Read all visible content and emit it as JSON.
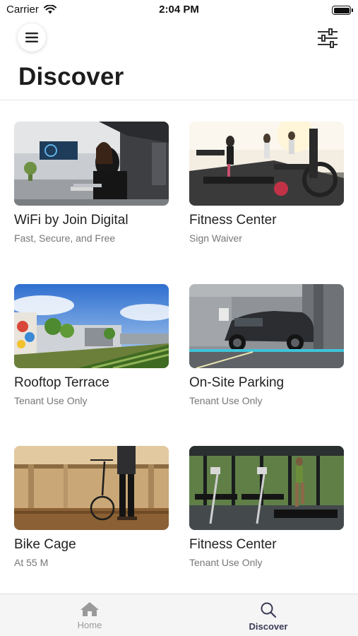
{
  "status_bar": {
    "carrier": "Carrier",
    "time": "2:04 PM"
  },
  "header": {
    "title": "Discover"
  },
  "cards": [
    {
      "title": "WiFi by Join Digital",
      "subtitle": "Fast, Secure, and Free"
    },
    {
      "title": "Fitness Center",
      "subtitle": "Sign Waiver"
    },
    {
      "title": "Rooftop Terrace",
      "subtitle": "Tenant Use Only"
    },
    {
      "title": "On-Site Parking",
      "subtitle": "Tenant Use Only"
    },
    {
      "title": "Bike Cage",
      "subtitle": "At 55 M"
    },
    {
      "title": "Fitness Center",
      "subtitle": "Tenant Use Only"
    }
  ],
  "tab_bar": {
    "tabs": [
      {
        "label": "Home",
        "icon": "home-icon",
        "active": false
      },
      {
        "label": "Discover",
        "icon": "search-icon",
        "active": true
      }
    ]
  },
  "colors": {
    "active_tab": "#3a3a55",
    "inactive_tab": "#9a9a9a",
    "subtitle": "#777777"
  }
}
